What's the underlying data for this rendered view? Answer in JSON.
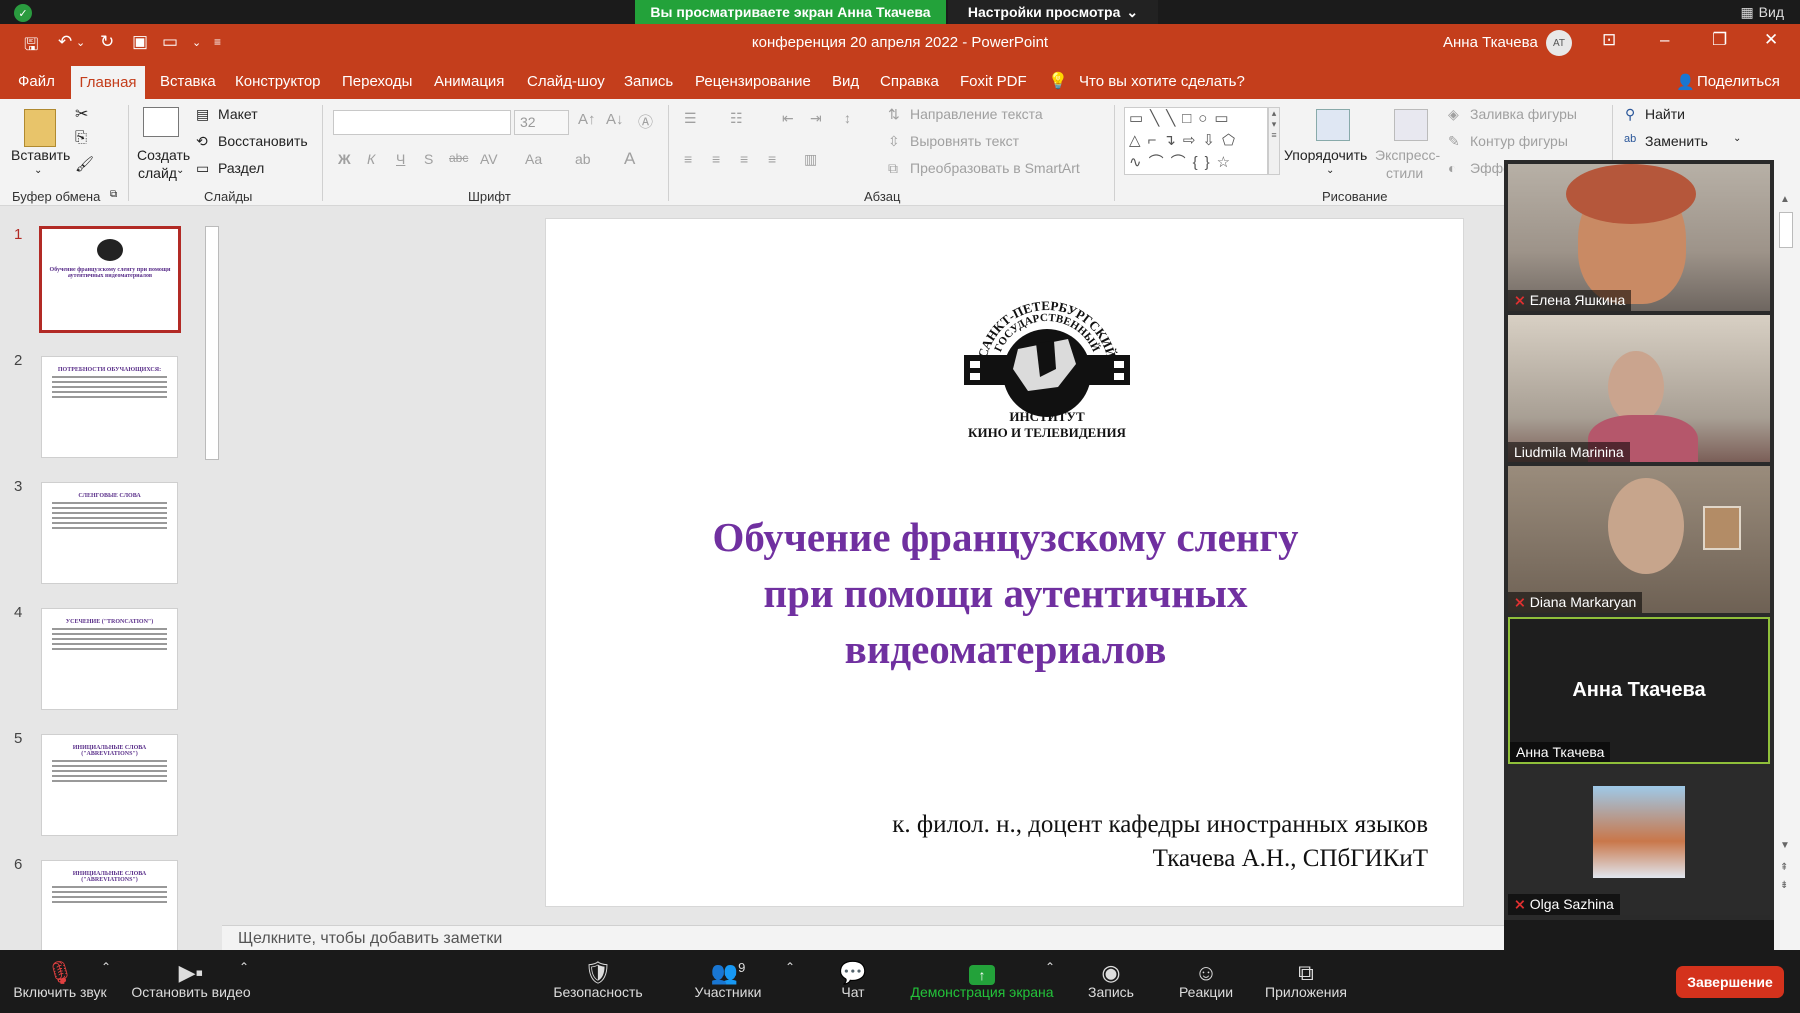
{
  "zoom_top": {
    "share_banner": "Вы просматриваете экран Анна Ткачева",
    "view_options": "Настройки просмотра",
    "view_label": "Вид"
  },
  "ppt": {
    "title": "конференция 20 апреля 2022  -  PowerPoint",
    "user_name": "Анна Ткачева",
    "avatar_initials": "АТ",
    "tabs": [
      "Файл",
      "Главная",
      "Вставка",
      "Конструктор",
      "Переходы",
      "Анимация",
      "Слайд-шоу",
      "Запись",
      "Рецензирование",
      "Вид",
      "Справка",
      "Foxit PDF"
    ],
    "tell_me": "Что вы хотите сделать?",
    "share": "Поделиться"
  },
  "ribbon": {
    "paste": "Вставить",
    "clipboard_group": "Буфер обмена",
    "new_slide_1": "Создать",
    "new_slide_2": "слайд",
    "layout": "Макет",
    "reset": "Восстановить",
    "section": "Раздел",
    "slides_group": "Слайды",
    "font_size": "32",
    "font_group": "Шрифт",
    "text_direction": "Направление текста",
    "align_text": "Выровнять текст",
    "smartart": "Преобразовать в SmartArt",
    "paragraph_group": "Абзац",
    "arrange": "Упорядочить",
    "quick_styles_1": "Экспресс-",
    "quick_styles_2": "стили",
    "shape_fill": "Заливка фигуры",
    "shape_outline": "Контур фигуры",
    "effects": "Эффе",
    "drawing_group": "Рисование",
    "find": "Найти",
    "replace": "Заменить"
  },
  "thumbnails": [
    {
      "num": "1",
      "title": "Обучение французскому сленгу при помощи аутентичных видеоматериалов"
    },
    {
      "num": "2",
      "title": "ПОТРЕБНОСТИ ОБУЧАЮЩИХСЯ:"
    },
    {
      "num": "3",
      "title": "СЛЕНГОВЫЕ СЛОВА"
    },
    {
      "num": "4",
      "title": "УСЕЧЕНИЕ (\"TRONCATION\")"
    },
    {
      "num": "5",
      "title": "ИНИЦИАЛЬНЫЕ СЛОВА (\"ABREVIATIONS\")"
    },
    {
      "num": "6",
      "title": "ИНИЦИАЛЬНЫЕ СЛОВА (\"ABREVIATIONS\")"
    }
  ],
  "slide": {
    "logo_top": "САНКТ-ПЕТЕРБУРГСКИЙ ГОСУДАРСТВЕННЫЙ",
    "logo_inst": "ИНСТИТУТ",
    "logo_bottom": "КИНО И ТЕЛЕВИДЕНИЯ",
    "title_line1": "Обучение французскому сленгу",
    "title_line2": "при помощи аутентичных",
    "title_line3": "видеоматериалов",
    "subtitle_line1": "к. филол. н., доцент кафедры иностранных языков",
    "subtitle_line2": "Ткачева А.Н., СПбГИКиТ",
    "title_color": "#7030a0"
  },
  "notes_placeholder": "Щелкните, чтобы добавить заметки",
  "participants": [
    {
      "name": "Елена Яшкина",
      "muted": true
    },
    {
      "name": "Liudmila Marinina",
      "muted": false
    },
    {
      "name": "Diana Markaryan",
      "muted": true
    },
    {
      "name": "Анна Ткачева",
      "muted": false,
      "center_name": "Анна Ткачева"
    },
    {
      "name": "Olga Sazhina",
      "muted": true
    }
  ],
  "zoom_bottom": {
    "unmute": "Включить звук",
    "stop_video": "Остановить видео",
    "security": "Безопасность",
    "participants": "Участники",
    "participants_count": "9",
    "chat": "Чат",
    "share_screen": "Демонстрация экрана",
    "record": "Запись",
    "reactions": "Реакции",
    "apps": "Приложения",
    "end": "Завершение"
  },
  "colors": {
    "ppt_red": "#c43e1c",
    "zoom_green": "#23a23a",
    "end_red": "#d4321c"
  }
}
